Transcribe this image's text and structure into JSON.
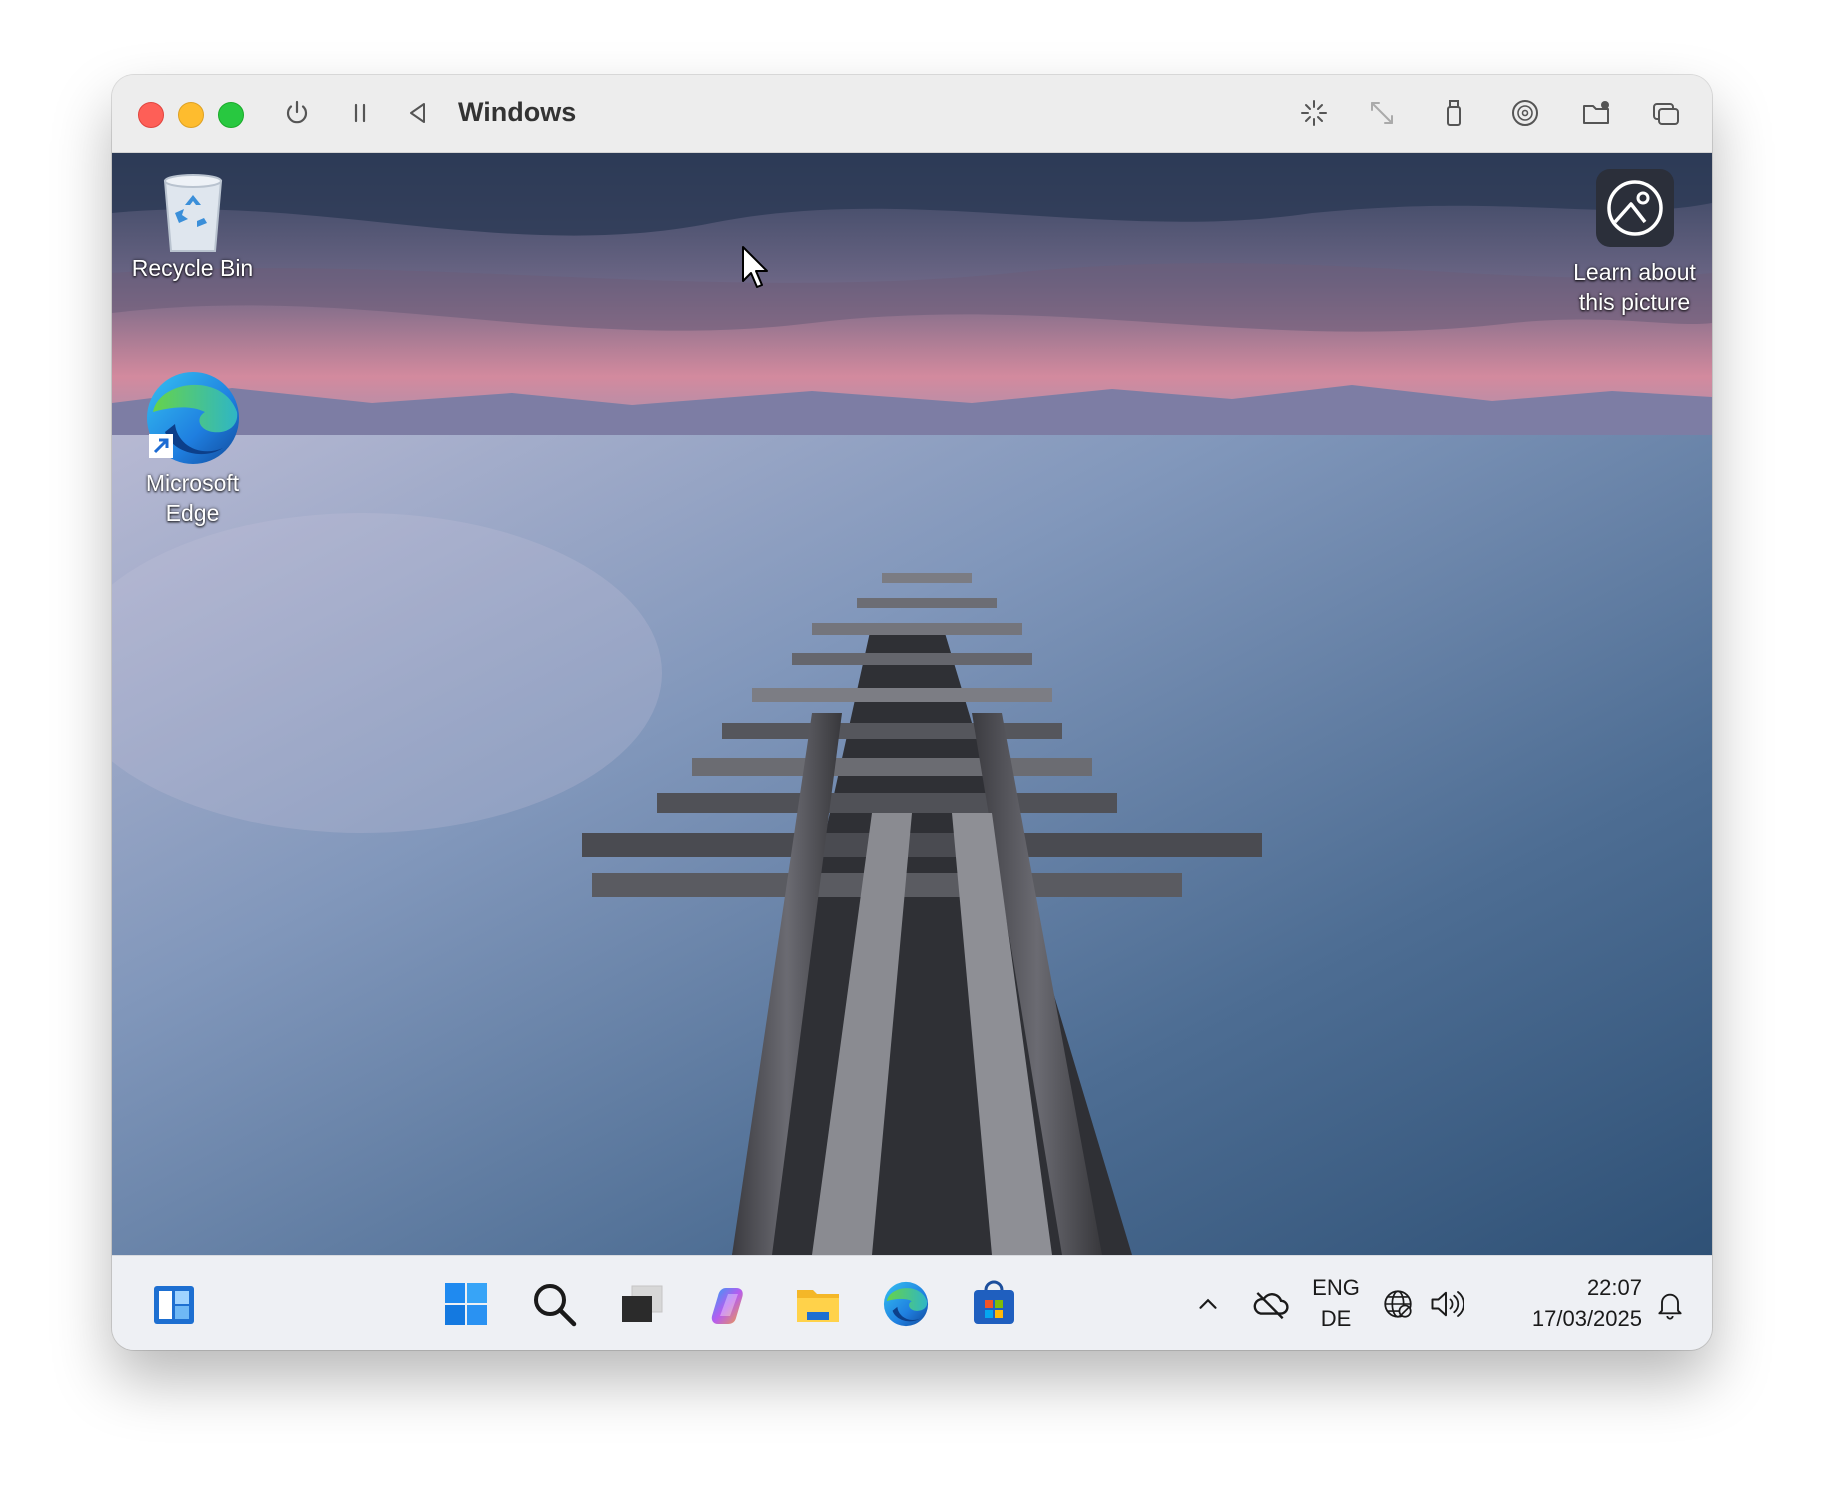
{
  "window": {
    "title": "Windows",
    "toolbar_left_icons": [
      "power-icon",
      "pause-icon",
      "back-icon"
    ],
    "toolbar_right_icons": [
      "tap-icon",
      "resize-icon",
      "usb-icon",
      "disc-icon",
      "shared-folder-icon",
      "windows-switch-icon"
    ]
  },
  "desktop": {
    "icons": [
      {
        "label": "Recycle Bin",
        "icon": "recycle-bin-icon"
      },
      {
        "label": "Microsoft\nEdge",
        "label_line1": "Microsoft",
        "label_line2": "Edge",
        "icon": "edge-icon"
      }
    ],
    "spotlight": {
      "line1": "Learn about",
      "line2": "this picture",
      "icon": "spotlight-icon"
    }
  },
  "taskbar": {
    "apps": [
      "widgets-icon",
      "start-icon",
      "search-icon",
      "task-view-icon",
      "copilot-icon",
      "file-explorer-icon",
      "edge-icon",
      "store-icon"
    ],
    "tray": {
      "chevron": "show-hidden-icons",
      "onedrive": "onedrive-icon",
      "lang_line1": "ENG",
      "lang_line2": "DE",
      "network": "network-icon",
      "volume": "volume-icon",
      "time": "22:07",
      "date": "17/03/2025",
      "notification": "notification-bell-icon"
    }
  },
  "colors": {
    "close": "#fe5f57",
    "minimize": "#febc2e",
    "zoom": "#28c840",
    "taskbar_bg": "#eef0f4"
  }
}
